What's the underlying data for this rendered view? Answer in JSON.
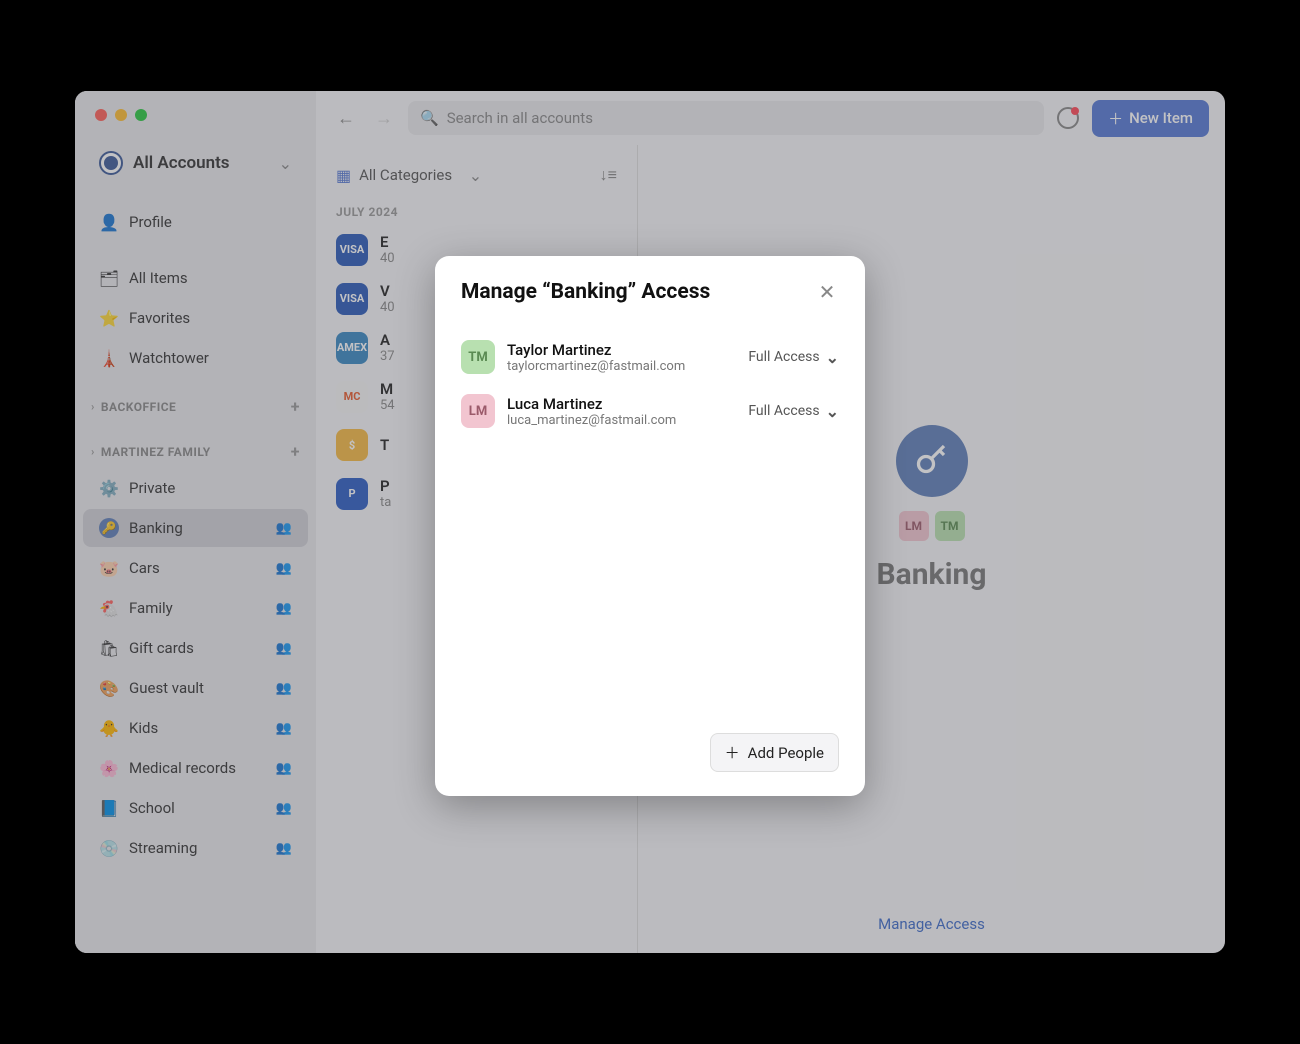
{
  "account_selector": {
    "label": "All Accounts"
  },
  "sidebar": {
    "nav": [
      {
        "label": "Profile",
        "icon": "👤",
        "icon_name": "profile-icon"
      },
      {
        "label": "All Items",
        "icon": "🗂",
        "icon_name": "all-items-icon"
      },
      {
        "label": "Favorites",
        "icon": "⭐",
        "icon_name": "star-icon"
      },
      {
        "label": "Watchtower",
        "icon": "🗼",
        "icon_name": "watchtower-icon"
      }
    ],
    "sections": [
      {
        "label": "BACKOFFICE",
        "items": []
      },
      {
        "label": "MARTINEZ FAMILY",
        "items": [
          {
            "label": "Private",
            "icon": "⚙️",
            "shared": false,
            "selected": false
          },
          {
            "label": "Banking",
            "icon": "🔑",
            "shared": true,
            "selected": true,
            "icon_bg": "#5e7eb8"
          },
          {
            "label": "Cars",
            "icon": "🐷",
            "shared": true
          },
          {
            "label": "Family",
            "icon": "🐔",
            "shared": true
          },
          {
            "label": "Gift cards",
            "icon": "🛍",
            "shared": true
          },
          {
            "label": "Guest vault",
            "icon": "🎨",
            "shared": true
          },
          {
            "label": "Kids",
            "icon": "🐥",
            "shared": true
          },
          {
            "label": "Medical records",
            "icon": "🌸",
            "shared": true
          },
          {
            "label": "School",
            "icon": "📘",
            "shared": true
          },
          {
            "label": "Streaming",
            "icon": "💿",
            "shared": true
          }
        ]
      }
    ]
  },
  "toolbar": {
    "search_placeholder": "Search in all accounts",
    "new_item_label": "New Item"
  },
  "list": {
    "header_label": "All Categories",
    "section_label": "JULY 2024",
    "items": [
      {
        "title": "E",
        "sub": "40",
        "icon_text": "VISA",
        "icon_bg": "#2a5ab8"
      },
      {
        "title": "V",
        "sub": "40",
        "icon_text": "VISA",
        "icon_bg": "#2a5ab8"
      },
      {
        "title": "A",
        "sub": "37",
        "icon_text": "AMEX",
        "icon_bg": "#3887c2"
      },
      {
        "title": "M",
        "sub": "54",
        "icon_text": "MC",
        "icon_bg": "#f5f5f5"
      },
      {
        "title": "T",
        "sub": "",
        "icon_text": "$",
        "icon_bg": "#f5b942"
      },
      {
        "title": "P",
        "sub": "ta",
        "icon_text": "P",
        "icon_bg": "#2b5cc4"
      }
    ]
  },
  "detail": {
    "title": "Banking",
    "avatars": [
      {
        "initials": "LM",
        "class": "ab-lm"
      },
      {
        "initials": "TM",
        "class": "ab-tm"
      }
    ],
    "manage_label": "Manage Access"
  },
  "modal": {
    "title": "Manage “Banking” Access",
    "people": [
      {
        "name": "Taylor Martinez",
        "email": "taylorcmartinez@fastmail.com",
        "initials": "TM",
        "avatar_bg": "#b8e0b0",
        "avatar_color": "#5a8a52",
        "access": "Full Access"
      },
      {
        "name": "Luca Martinez",
        "email": "luca_martinez@fastmail.com",
        "initials": "LM",
        "avatar_bg": "#f2c5d0",
        "avatar_color": "#9b5a6a",
        "access": "Full Access"
      }
    ],
    "add_label": "Add People"
  }
}
